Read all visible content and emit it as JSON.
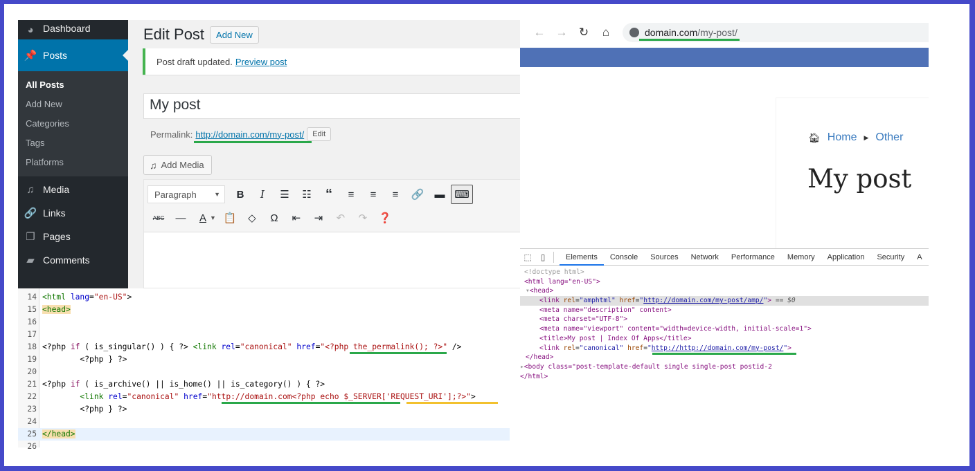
{
  "wp": {
    "sidebar": {
      "dashboard": {
        "label": "Dashboard",
        "icon": "dashboard-icon"
      },
      "posts": {
        "label": "Posts",
        "icon": "pin-icon"
      },
      "submenu": [
        "All Posts",
        "Add New",
        "Categories",
        "Tags",
        "Platforms"
      ],
      "media": {
        "label": "Media",
        "icon": "media-icon"
      },
      "links": {
        "label": "Links",
        "icon": "link-icon"
      },
      "pages": {
        "label": "Pages",
        "icon": "pages-icon"
      },
      "comments": {
        "label": "Comments",
        "icon": "comment-icon"
      }
    },
    "page_title": "Edit Post",
    "add_new": "Add New",
    "notice": {
      "text": "Post draft updated.",
      "link": "Preview post"
    },
    "post_title": "My post",
    "permalink": {
      "label": "Permalink:",
      "url": "http://domain.com/my-post/",
      "edit": "Edit"
    },
    "add_media": "Add Media",
    "format_select": "Paragraph",
    "toolbar_row1": [
      "bold",
      "italic",
      "bullet-list",
      "numbered-list",
      "blockquote",
      "align-left",
      "align-center",
      "align-right",
      "link",
      "read-more",
      "toolbar-toggle"
    ],
    "toolbar_row2": [
      "strikethrough",
      "horizontal-line",
      "text-color",
      "paste-text",
      "clear-formatting",
      "special-character",
      "outdent",
      "indent",
      "undo",
      "redo",
      "help"
    ]
  },
  "code": {
    "lines": [
      {
        "n": "14",
        "text": "<html lang=\"en-US\">"
      },
      {
        "n": "15",
        "text": "<head>"
      },
      {
        "n": "16",
        "text": ""
      },
      {
        "n": "17",
        "text": ""
      },
      {
        "n": "18",
        "text": "<?php if ( is_singular() ) { ?> <link rel=\"canonical\" href=\"<?php the_permalink(); ?>\" />"
      },
      {
        "n": "19",
        "text": "        <?php } ?>"
      },
      {
        "n": "20",
        "text": ""
      },
      {
        "n": "21",
        "text": "<?php if ( is_archive() || is_home() || is_category() ) { ?>"
      },
      {
        "n": "22",
        "text": "        <link rel=\"canonical\" href=\"http://domain.com<?php echo $_SERVER['REQUEST_URI'];?>\">"
      },
      {
        "n": "23",
        "text": "        <?php } ?>"
      },
      {
        "n": "24",
        "text": ""
      },
      {
        "n": "25",
        "text": "</head>"
      },
      {
        "n": "26",
        "text": ""
      }
    ]
  },
  "browser": {
    "back": "back-icon",
    "forward": "forward-icon",
    "reload": "reload-icon",
    "home": "home-icon",
    "url_host": "domain.com",
    "url_path": "/my-post/",
    "breadcrumb": [
      "Home",
      "Other"
    ],
    "post_title": "My post"
  },
  "devtools": {
    "tabs": [
      "Elements",
      "Console",
      "Sources",
      "Network",
      "Performance",
      "Memory",
      "Application",
      "Security",
      "A"
    ],
    "active_tab": "Elements",
    "dom": {
      "doctype": "<!doctype html>",
      "html_open": "<html lang=\"en-US\">",
      "head_open": "<head>",
      "amp_href": "http://domain.com/my-post/amp/",
      "selected_marker": "== $0",
      "meta_description": "<meta name=\"description\" content>",
      "meta_charset": "<meta charset=\"UTF-8\">",
      "meta_viewport": "<meta name=\"viewport\" content=\"width=device-width, initial-scale=1\">",
      "title": "<title>My post | Index Of Apps</title>",
      "canonical_href": "http://http://domain.com/my-post/",
      "head_close": "</head>",
      "body": "<body class=\"post-template-default single single-post postid-2",
      "html_close": "</html>"
    }
  },
  "colors": {
    "frame": "#4549c9",
    "wp_accent": "#0073aa",
    "highlight_green": "#2aa84a",
    "highlight_yellow": "#f2c12e",
    "site_bar": "#4f71b6"
  }
}
